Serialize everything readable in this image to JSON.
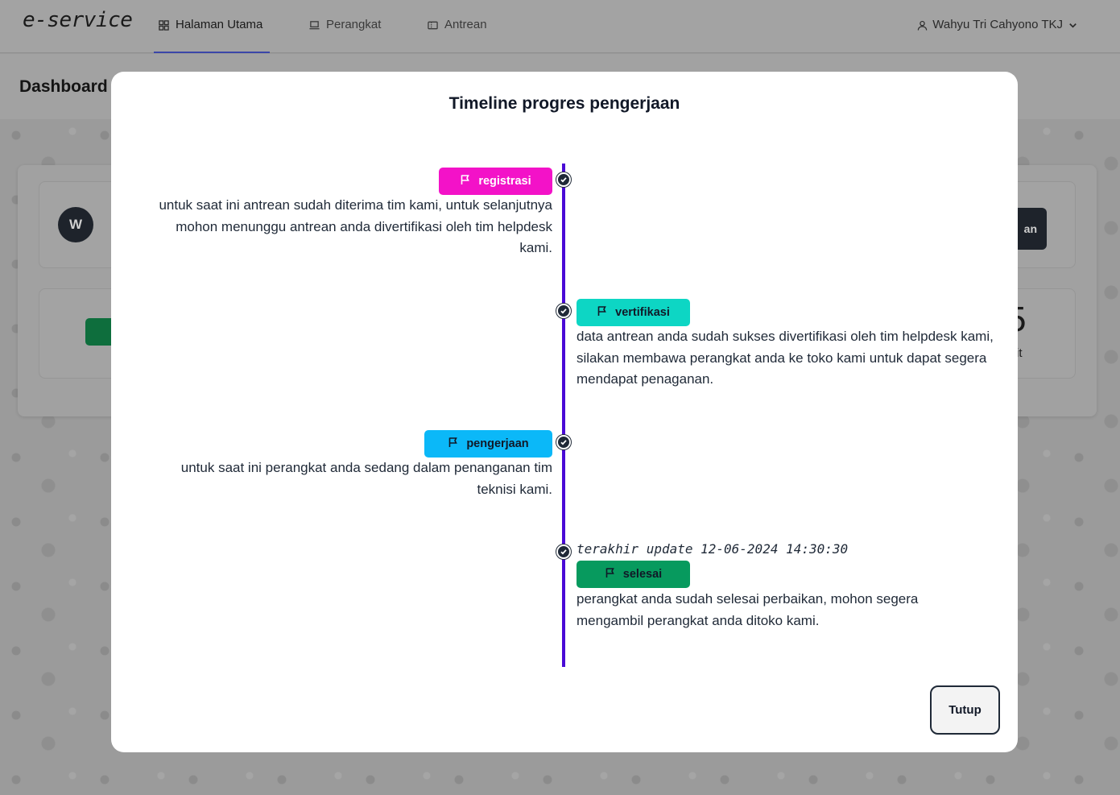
{
  "navbar": {
    "brand": "e-service",
    "items": [
      {
        "label": "Halaman Utama",
        "icon": "grid-icon",
        "active": true
      },
      {
        "label": "Perangkat",
        "icon": "laptop-icon",
        "active": false
      },
      {
        "label": "Antrean",
        "icon": "ticket-icon",
        "active": false
      }
    ],
    "user": {
      "name": "Wahyu Tri Cahyono TKJ",
      "icon": "user-icon"
    }
  },
  "page": {
    "title": "Dashboard",
    "avatar_initial": "W",
    "partial_button_label": "an",
    "partial_number": "5",
    "partial_caption": "it"
  },
  "modal": {
    "title": "Timeline progres pengerjaan",
    "close_label": "Tutup",
    "timeline_color": "#4a0ad6",
    "steps": [
      {
        "label": "registrasi",
        "color": "#f312c8",
        "text_color": "#ffffff",
        "description": "untuk saat ini antrean sudah diterima tim kami, untuk selanjutnya mohon menunggu antrean anda divertifikasi oleh tim helpdesk kami."
      },
      {
        "label": "vertifikasi",
        "color": "#0dd6c4",
        "text_color": "#111827",
        "description": "data antrean anda sudah sukses divertifikasi oleh tim helpdesk kami, silakan membawa perangkat anda ke toko kami untuk dapat segera mendapat penaganan."
      },
      {
        "label": "pengerjaan",
        "color": "#0bb8f8",
        "text_color": "#111827",
        "description": "untuk saat ini perangkat anda sedang dalam penanganan tim teknisi kami."
      },
      {
        "label": "selesai",
        "color": "#079a5e",
        "text_color": "#111827",
        "timestamp": "terakhir update 12-06-2024 14:30:30",
        "description": "perangkat anda sudah selesai perbaikan, mohon segera mengambil perangkat anda ditoko kami."
      }
    ]
  }
}
